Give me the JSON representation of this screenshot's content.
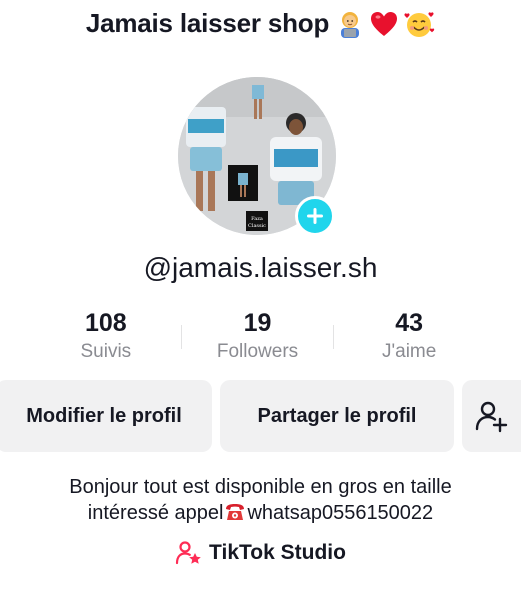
{
  "header": {
    "title": "Jamais laisser shop",
    "title_emojis": [
      "woman-technologist",
      "red-heart",
      "smiling-face-with-hearts"
    ]
  },
  "profile": {
    "avatar_label": "Faza Classic",
    "username": "@jamais.laisser.sh"
  },
  "stats": [
    {
      "value": "108",
      "label": "Suivis"
    },
    {
      "value": "19",
      "label": "Followers"
    },
    {
      "value": "43",
      "label": "J'aime"
    }
  ],
  "actions": {
    "edit_label": "Modifier le profil",
    "share_label": "Partager le profil"
  },
  "bio": {
    "line1": "Bonjour tout est disponible en gros en taille",
    "line2_prefix": "intéressé appel",
    "line2_suffix": "whatsap0556150022"
  },
  "studio": {
    "label": "TikTok Studio"
  },
  "colors": {
    "accent": "#20d5ec",
    "button_bg": "#f1f1f2",
    "secondary_text": "#8a8b91",
    "studio_pink": "#fe2c55"
  }
}
